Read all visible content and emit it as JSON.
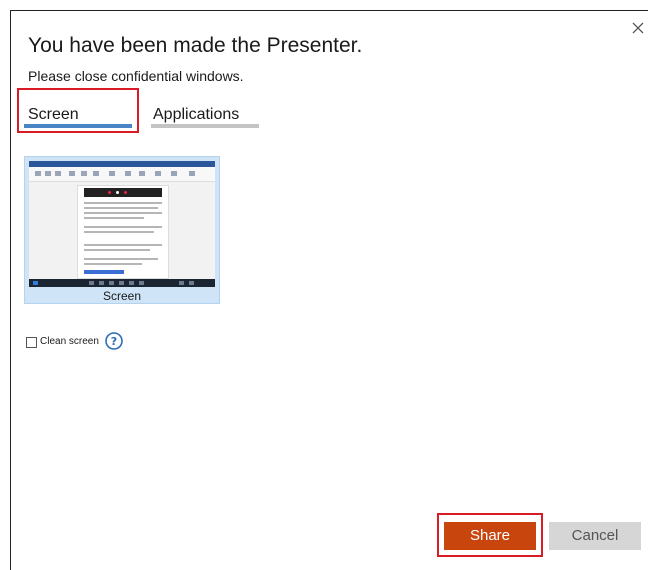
{
  "dialog": {
    "title": "You have been made the Presenter.",
    "subtitle": "Please close confidential windows.",
    "close_icon": "close-icon"
  },
  "tabs": [
    {
      "label": "Screen",
      "selected": true
    },
    {
      "label": "Applications",
      "selected": false
    }
  ],
  "thumbnail": {
    "label": "Screen"
  },
  "clean_screen": {
    "label": "Clean screen",
    "checked": false,
    "help_icon": "help-icon"
  },
  "buttons": {
    "share_label": "Share",
    "cancel_label": "Cancel"
  },
  "colors": {
    "share_button": "#c8450e",
    "cancel_button": "#d6d6d6",
    "selected_tab_indicator": "#4a86c6",
    "highlight_annotation": "#d81b24"
  }
}
